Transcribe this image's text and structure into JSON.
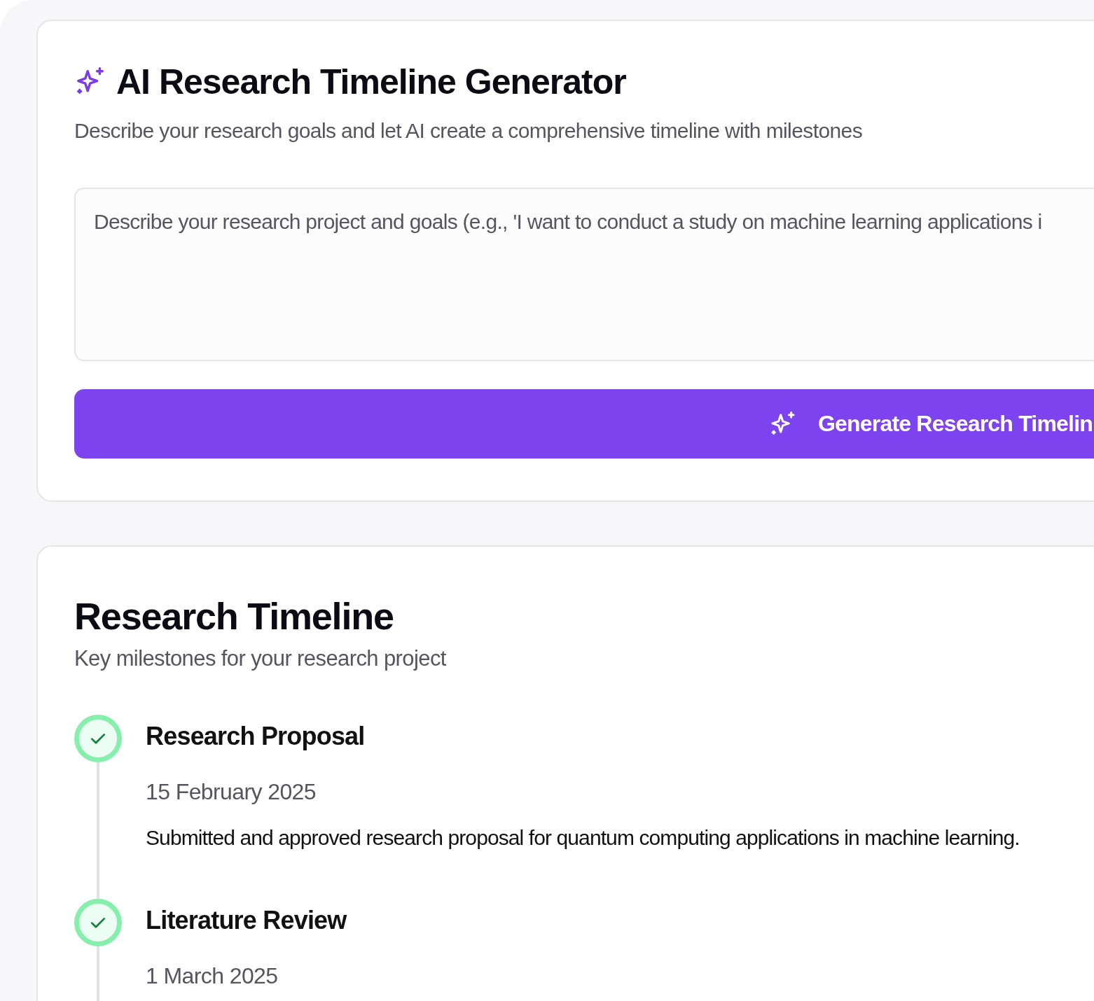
{
  "generator": {
    "title": "AI Research Timeline Generator",
    "subtitle": "Describe your research goals and let AI create a comprehensive timeline with milestones",
    "input": {
      "placeholder": "Describe your research project and goals (e.g., 'I want to conduct a study on machine learning applications i"
    },
    "button": "Generate Research Timelin"
  },
  "timeline": {
    "title": "Research Timeline",
    "subtitle": "Key milestones for your research project",
    "milestones": [
      {
        "title": "Research Proposal",
        "date": "15 February 2025",
        "description": "Submitted and approved research proposal for quantum computing applications in machine learning.",
        "completed": true
      },
      {
        "title": "Literature Review",
        "date": "1 March 2025",
        "completed": true
      }
    ]
  }
}
